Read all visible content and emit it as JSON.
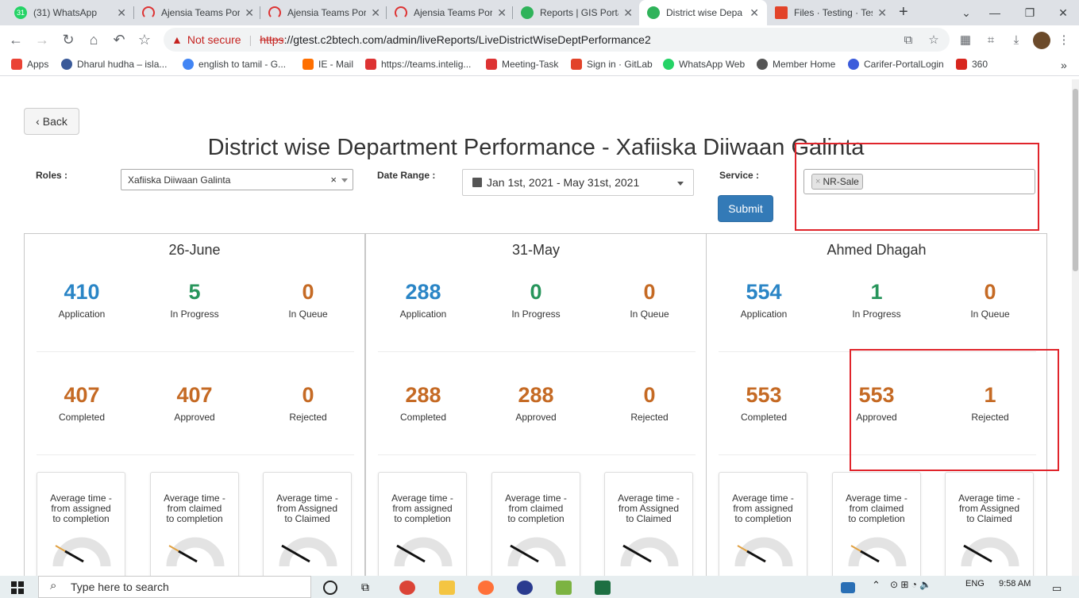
{
  "browser": {
    "tabs": [
      {
        "title": "(31) WhatsApp",
        "icon": "whatsapp-icon",
        "color": "#25d366",
        "badge": "31"
      },
      {
        "title": "Ajensia Teams Por",
        "icon": "teams-icon",
        "color": "#d33"
      },
      {
        "title": "Ajensia Teams Por",
        "icon": "teams-icon",
        "color": "#d33"
      },
      {
        "title": "Ajensia Teams Por",
        "icon": "teams-icon",
        "color": "#d33"
      },
      {
        "title": "Reports | GIS Porta",
        "icon": "gis-icon",
        "color": "#2fb35a"
      },
      {
        "title": "District wise Depa",
        "icon": "gis-icon",
        "color": "#2fb35a",
        "active": true
      },
      {
        "title": "Files · Testing · Tes",
        "icon": "gitlab-icon",
        "color": "#e24329"
      }
    ],
    "address": {
      "warning": "Not secure",
      "scheme": "https",
      "url_rest": "://gtest.c2btech.com/admin/liveReports/LiveDistrictWiseDeptPerformance2"
    },
    "bookmarks": [
      {
        "label": "Apps",
        "color": "#ea4335"
      },
      {
        "label": "Dharul hudha – isla...",
        "color": "#3a5a99"
      },
      {
        "label": "english to tamil - G...",
        "color": "#4285f4"
      },
      {
        "label": "IE - Mail",
        "color": "#ff6f00"
      },
      {
        "label": "https://teams.intelig...",
        "color": "#d33"
      },
      {
        "label": "Meeting-Task",
        "color": "#d33"
      },
      {
        "label": "Sign in · GitLab",
        "color": "#e24329"
      },
      {
        "label": "WhatsApp Web",
        "color": "#25d366"
      },
      {
        "label": "Member Home",
        "color": "#555"
      },
      {
        "label": "Carifer-PortalLogin",
        "color": "#3b5bdb"
      },
      {
        "label": "360",
        "color": "#d7261e"
      }
    ]
  },
  "page": {
    "back_label": "Back",
    "title": "District wise Department Performance - Xafiiska Diiwaan Galinta",
    "filters": {
      "roles_label": "Roles :",
      "roles_value": "Xafiiska Diiwaan Galinta",
      "date_label": "Date Range :",
      "date_value": "Jan 1st, 2021 - May 31st, 2021",
      "service_label": "Service :",
      "service_chip": "NR-Sale",
      "submit_label": "Submit"
    },
    "panels": [
      {
        "name": "26-June",
        "stats": [
          {
            "value": "410",
            "label": "Application"
          },
          {
            "value": "5",
            "label": "In Progress"
          },
          {
            "value": "0",
            "label": "In Queue"
          },
          {
            "value": "407",
            "label": "Completed"
          },
          {
            "value": "407",
            "label": "Approved"
          },
          {
            "value": "0",
            "label": "Rejected"
          }
        ],
        "avg": [
          {
            "line1": "Average time -",
            "line2": "from assigned",
            "line3": "to completion"
          },
          {
            "line1": "Average time -",
            "line2": "from claimed",
            "line3": "to completion"
          },
          {
            "line1": "Average time -",
            "line2": "from Assigned",
            "line3": "to Claimed"
          }
        ]
      },
      {
        "name": "31-May",
        "stats": [
          {
            "value": "288",
            "label": "Application"
          },
          {
            "value": "0",
            "label": "In Progress"
          },
          {
            "value": "0",
            "label": "In Queue"
          },
          {
            "value": "288",
            "label": "Completed"
          },
          {
            "value": "288",
            "label": "Approved"
          },
          {
            "value": "0",
            "label": "Rejected"
          }
        ],
        "avg": [
          {
            "line1": "Average time -",
            "line2": "from assigned",
            "line3": "to completion"
          },
          {
            "line1": "Average time -",
            "line2": "from claimed",
            "line3": "to completion"
          },
          {
            "line1": "Average time -",
            "line2": "from Assigned",
            "line3": "to Claimed"
          }
        ]
      },
      {
        "name": "Ahmed Dhagah",
        "stats": [
          {
            "value": "554",
            "label": "Application"
          },
          {
            "value": "1",
            "label": "In Progress"
          },
          {
            "value": "0",
            "label": "In Queue"
          },
          {
            "value": "553",
            "label": "Completed"
          },
          {
            "value": "553",
            "label": "Approved"
          },
          {
            "value": "1",
            "label": "Rejected"
          }
        ],
        "avg": [
          {
            "line1": "Average time -",
            "line2": "from assigned",
            "line3": "to completion"
          },
          {
            "line1": "Average time -",
            "line2": "from claimed",
            "line3": "to completion"
          },
          {
            "line1": "Average time -",
            "line2": "from Assigned",
            "line3": "to Claimed"
          }
        ]
      }
    ]
  },
  "taskbar": {
    "search_placeholder": "Type here to search",
    "lang": "ENG",
    "time": "9:58 AM"
  },
  "colors": {
    "application": "#2a85c6",
    "in_progress": "#27955b",
    "orange": "#c56a24",
    "highlight": "#e0242b",
    "primary_button": "#337ab7"
  }
}
